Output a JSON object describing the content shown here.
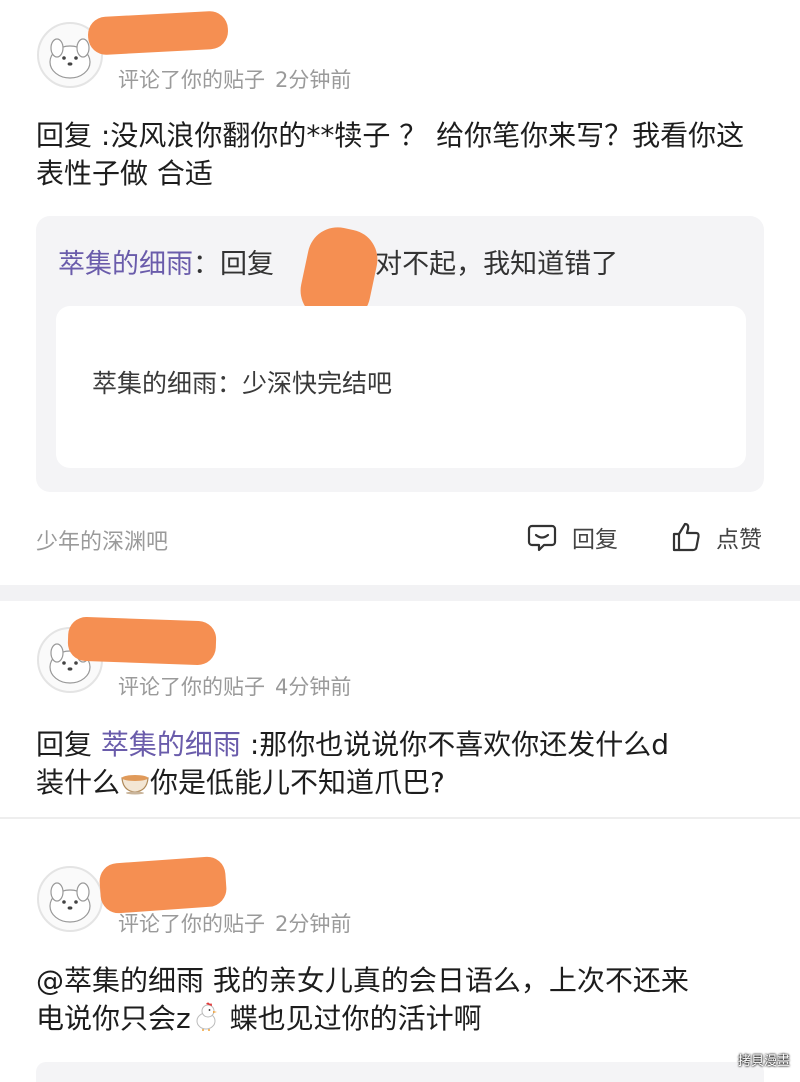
{
  "posts": [
    {
      "meta_action": "评论了你的贴子",
      "time": "2分钟前",
      "content": "回复 :没风浪你翻你的**犊子 ？ 给你笔你来写？我看你这表性子做 合适",
      "quote": {
        "author": "萃集的细雨",
        "reply_prefix": "：回复",
        "reply_text": ":对不起，我知道错了",
        "inner_author": "萃集的细雨",
        "inner_text": "：少深快完结吧"
      },
      "forum": "少年的深渊吧",
      "reply_label": "回复",
      "like_label": "点赞"
    },
    {
      "meta_action": "评论了你的贴子",
      "time": "4分钟前",
      "content_prefix": "回复",
      "mention": "萃集的细雨",
      "content_line1_rest": ":那你也说说你不喜欢你还发什么d",
      "content_line2_a": "装什么",
      "content_line2_b": "你是低能儿不知道爪巴?"
    },
    {
      "meta_action": "评论了你的贴子",
      "time": "2分钟前",
      "content_line1": "@萃集的细雨 我的亲女儿真的会日语么，上次不还来",
      "content_line2_a": "电说你只会z",
      "content_line2_b": " 蝶也见过你的活计啊"
    }
  ],
  "icons": {
    "reply": "comment-bubble-icon",
    "like": "thumbs-up-icon",
    "cup": "teacup-emoji",
    "chicken": "chicken-emoji"
  },
  "colors": {
    "mention": "#6a5cab",
    "redaction": "#f58f52",
    "meta": "#9a9a9a",
    "quote_bg": "#f4f4f6"
  },
  "watermark": "拷貝漫畫"
}
